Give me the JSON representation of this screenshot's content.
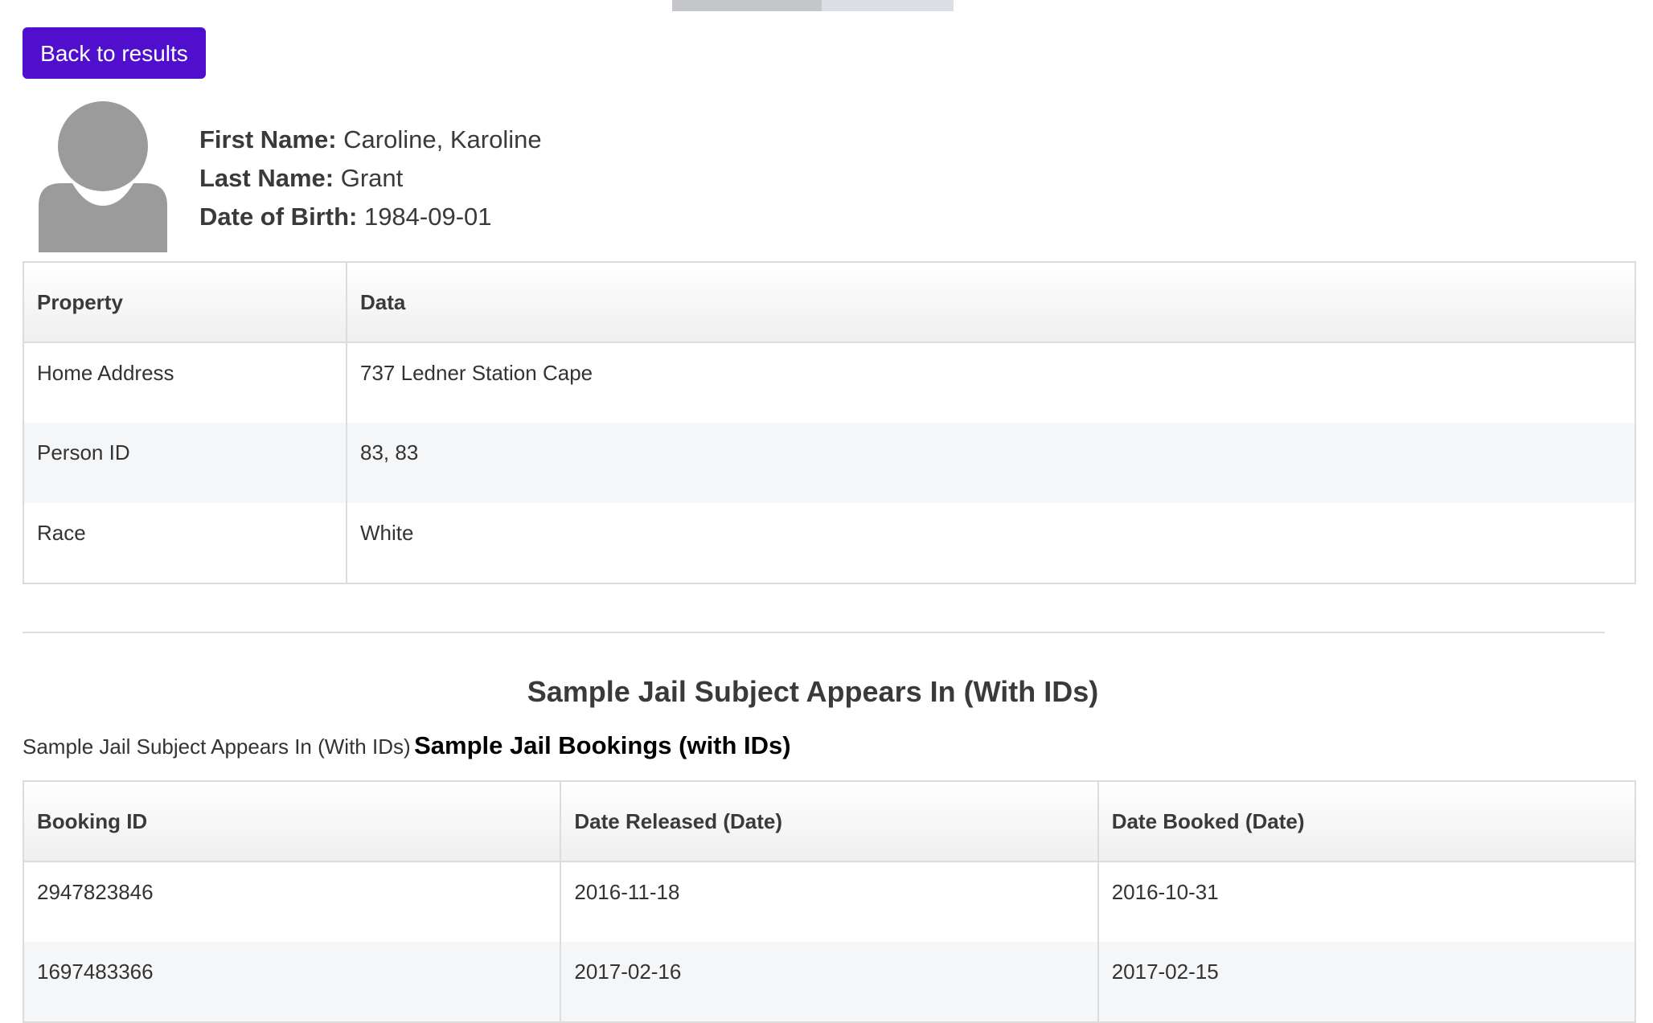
{
  "navigation": {
    "back_label": "Back to results"
  },
  "person": {
    "first_name_label": "First Name:",
    "first_name": "Caroline, Karoline",
    "last_name_label": "Last Name:",
    "last_name": "Grant",
    "dob_label": "Date of Birth:",
    "dob": "1984-09-01"
  },
  "properties_table": {
    "headers": [
      "Property",
      "Data"
    ],
    "rows": [
      [
        "Home Address",
        "737 Ledner Station Cape"
      ],
      [
        "Person ID",
        "83, 83"
      ],
      [
        "Race",
        "White"
      ]
    ]
  },
  "appears_in": {
    "title": "Sample Jail Subject Appears In (With IDs)",
    "subtitle_small": "Sample Jail Subject Appears In (With IDs)",
    "subtitle_big": "Sample Jail Bookings (with IDs)"
  },
  "bookings_table": {
    "headers": [
      "Booking ID",
      "Date Released (Date)",
      "Date Booked (Date)"
    ],
    "rows": [
      [
        "2947823846",
        "2016-11-18",
        "2016-10-31"
      ],
      [
        "1697483366",
        "2017-02-16",
        "2017-02-15"
      ]
    ]
  },
  "colors": {
    "primary_button": "#4f0fcc",
    "avatar": "#9b9b9b"
  }
}
